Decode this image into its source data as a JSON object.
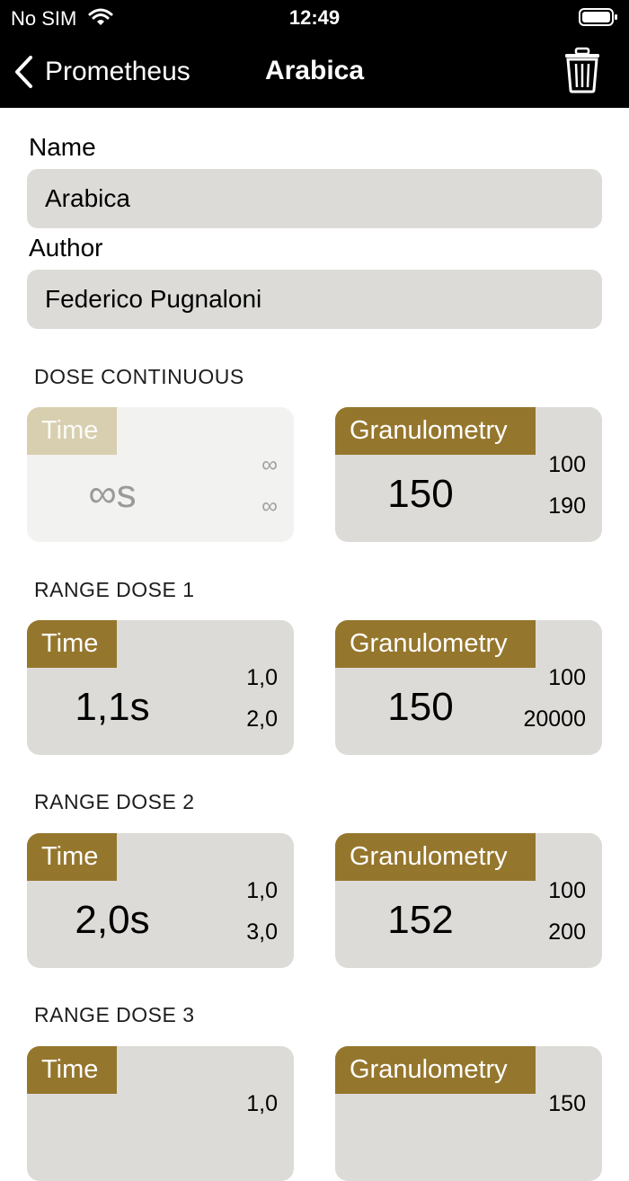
{
  "status": {
    "carrier": "No SIM",
    "time": "12:49"
  },
  "nav": {
    "back_label": "Prometheus",
    "title": "Arabica"
  },
  "form": {
    "name_label": "Name",
    "name_value": "Arabica",
    "author_label": "Author",
    "author_value": "Federico Pugnaloni"
  },
  "sections": [
    {
      "title": "DOSE CONTINUOUS",
      "time": {
        "label": "Time",
        "value": "∞s",
        "min": "∞",
        "max": "∞",
        "enabled": false
      },
      "gran": {
        "label": "Granulometry",
        "value": "150",
        "min": "100",
        "max": "190"
      }
    },
    {
      "title": "RANGE DOSE 1",
      "time": {
        "label": "Time",
        "value": "1,1s",
        "min": "1,0",
        "max": "2,0"
      },
      "gran": {
        "label": "Granulometry",
        "value": "150",
        "min": "100",
        "max": "20000"
      }
    },
    {
      "title": "RANGE DOSE 2",
      "time": {
        "label": "Time",
        "value": "2,0s",
        "min": "1,0",
        "max": "3,0"
      },
      "gran": {
        "label": "Granulometry",
        "value": "152",
        "min": "100",
        "max": "200"
      }
    },
    {
      "title": "RANGE DOSE 3",
      "time": {
        "label": "Time",
        "value": "",
        "min": "1,0",
        "max": ""
      },
      "gran": {
        "label": "Granulometry",
        "value": "",
        "min": "150",
        "max": ""
      }
    }
  ],
  "colors": {
    "accent": "#95762d",
    "accent_disabled": "#d8cfb0",
    "card": "#dcdbd7",
    "field": "#dcdbd7"
  },
  "icons": [
    "wifi-icon",
    "battery-icon",
    "chevron-left-icon",
    "trash-icon"
  ]
}
